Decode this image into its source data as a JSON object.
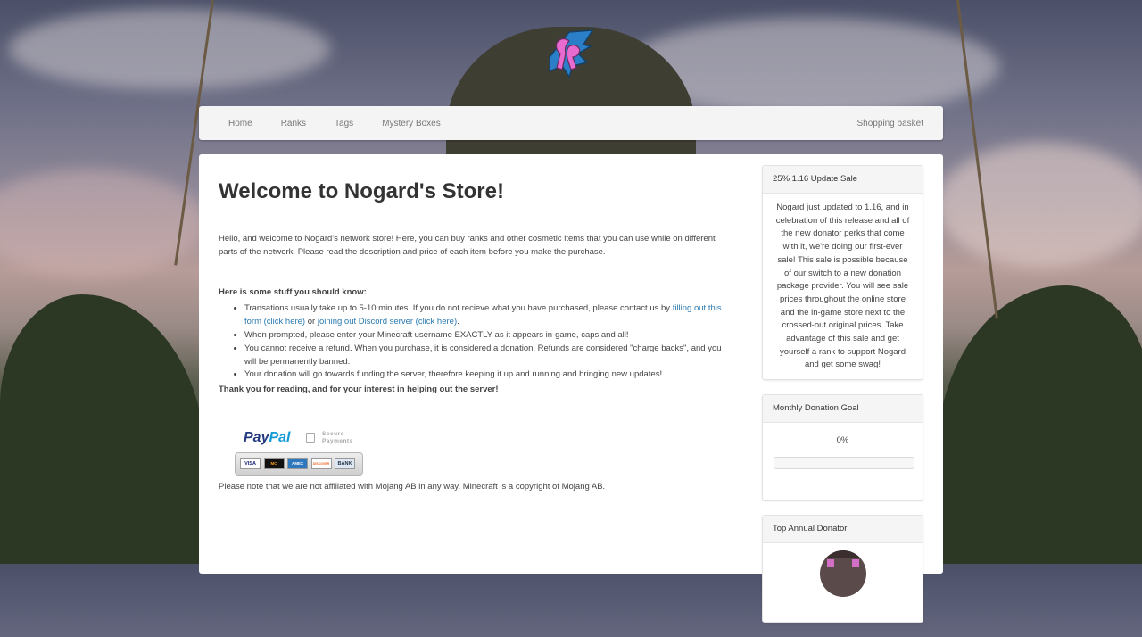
{
  "nav": {
    "items": [
      "Home",
      "Ranks",
      "Tags",
      "Mystery Boxes"
    ],
    "basket_label": "Shopping basket"
  },
  "main": {
    "title": "Welcome to Nogard's Store!",
    "intro": "Hello, and welcome to Nogard's network store! Here, you can buy ranks and other cosmetic items that you can use while on different parts of the network. Please read the description and price of each item before you make the purchase.",
    "stuff_heading": "Here is some stuff you should know:",
    "bullet1_text": "Transations usually take up to 5-10 minutes. If you do not recieve what you have purchased, please contact us by ",
    "bullet1_link1": "filling out this form (click here)",
    "bullet1_or": " or ",
    "bullet1_link2": "joining out Discord server (click here)",
    "bullet1_end": ".",
    "bullet2": "When prompted, please enter your Minecraft username EXACTLY as it appears in-game, caps and all!",
    "bullet3": "You cannot receive a refund. When you purchase, it is considered a donation. Refunds are considered \"charge backs\", and you will be permanently banned.",
    "bullet4": "Your donation will go towards funding the server, therefore keeping it up and running and bringing new updates!",
    "thanks": "Thank you for reading, and for your interest in helping out the server!",
    "paypal": {
      "pay": "Pay",
      "pal": "Pal",
      "secure": "Secure",
      "payments": "Payments",
      "cards": [
        "VISA",
        "MC",
        "AMEX",
        "DISCOVER",
        "BANK"
      ]
    },
    "disclaimer": "Please note that we are not affiliated with Mojang AB in any way. Minecraft is a copyright of Mojang AB."
  },
  "sidebar": {
    "sale_title": "25% 1.16 Update Sale",
    "sale_text": "Nogard just updated to 1.16, and in celebration of this release and all of the new donator perks that come with it, we're doing our first-ever sale! This sale is possible because of our switch to a new donation package provider. You will see sale prices throughout the online store and the in-game store next to the crossed-out original prices. Take advantage of this sale and get yourself a rank to support Nogard and get some swag!",
    "goal_title": "Monthly Donation Goal",
    "goal_percent_label": "0%",
    "goal_progress": 0,
    "top_title": "Top Annual Donator"
  },
  "colors": {
    "link": "#2a7ab0",
    "logo_pink": "#e86bd0",
    "logo_blue": "#2a7fc8"
  }
}
